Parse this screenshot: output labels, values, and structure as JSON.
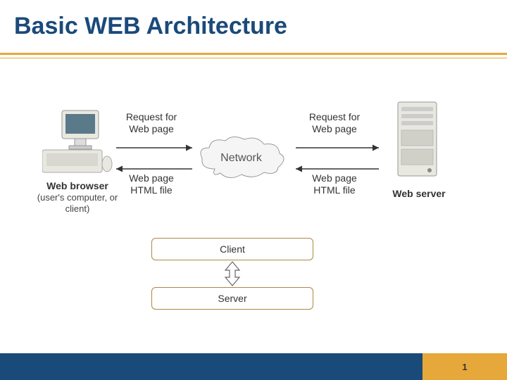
{
  "title": "Basic WEB Architecture",
  "diagram": {
    "browser": {
      "label": "Web browser",
      "sub": "(user's computer, or client)"
    },
    "network": {
      "label": "Network"
    },
    "server": {
      "label": "Web server"
    },
    "arrows": {
      "reqLeft": "Request for\nWeb page",
      "respLeft": "Web page\nHTML file",
      "reqRight": "Request for\nWeb page",
      "respRight": "Web page\nHTML file"
    },
    "boxes": {
      "client": "Client",
      "server": "Server"
    }
  },
  "footer": {
    "pageNumber": "1"
  }
}
